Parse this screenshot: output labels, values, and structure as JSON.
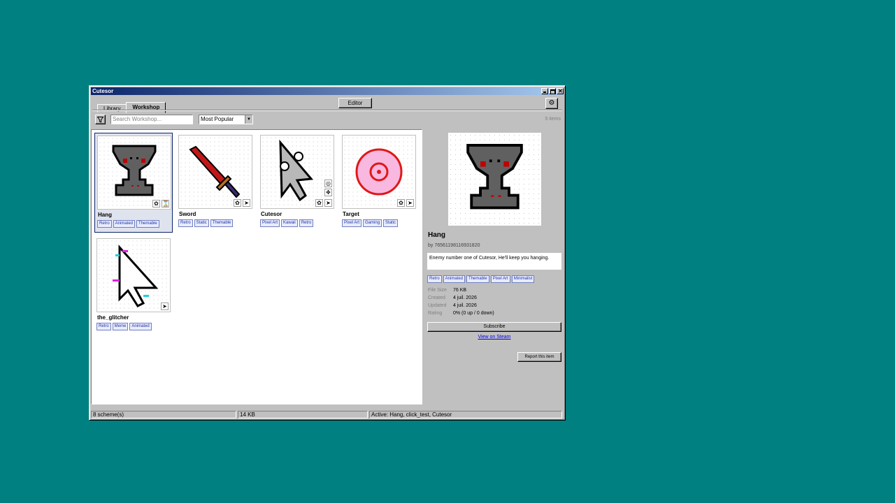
{
  "window": {
    "title": "Cutesor"
  },
  "tabs": [
    {
      "label": "Library"
    },
    {
      "label": "Workshop"
    }
  ],
  "toolbar": {
    "editor_label": "Editor",
    "search_placeholder": "Search Workshop...",
    "sort_selected": "Most Popular",
    "item_count": "5 items"
  },
  "items": [
    {
      "name": "Hang",
      "tags": [
        "Retro",
        "Animated",
        "Themable"
      ],
      "icon": "trophy-cursor"
    },
    {
      "name": "Sword",
      "tags": [
        "Retro",
        "Static",
        "Themable"
      ],
      "icon": "sword-cursor"
    },
    {
      "name": "Cutesor",
      "tags": [
        "Pixel Art",
        "Kawaii",
        "Retro"
      ],
      "icon": "cute-arrow-cursor"
    },
    {
      "name": "Target",
      "tags": [
        "Pixel Art",
        "Gaming",
        "Static"
      ],
      "icon": "target-cursor"
    },
    {
      "name": "the_glitcher",
      "tags": [
        "Retro",
        "Meme",
        "Animated"
      ],
      "icon": "glitch-arrow-cursor"
    }
  ],
  "detail": {
    "title": "Hang",
    "author": "by 76561198116931820",
    "description": "Enemy number one of Cutesor, He'll keep you hanging.",
    "tags": [
      "Retro",
      "Animated",
      "Themable",
      "Pixel Art",
      "Minimalist"
    ],
    "meta": [
      {
        "key": "File Size",
        "value": "76 KB"
      },
      {
        "key": "Created",
        "value": "4 juil. 2026"
      },
      {
        "key": "Updated",
        "value": "4 juil. 2026"
      },
      {
        "key": "Rating",
        "value": "0% (0 up / 0 down)"
      }
    ],
    "subscribe_label": "Subscribe",
    "steam_link": "View on Steam",
    "report_label": "Report this item"
  },
  "statusbar": {
    "schemes": "8 scheme(s)",
    "size": "14 KB",
    "active": "Active: Hang, click_test, Cutesor"
  },
  "colors": {
    "desktop": "#008080",
    "title_start": "#0a246a",
    "title_end": "#a6caf0",
    "selection": "#0a246a",
    "tag_border": "#7080c0"
  }
}
